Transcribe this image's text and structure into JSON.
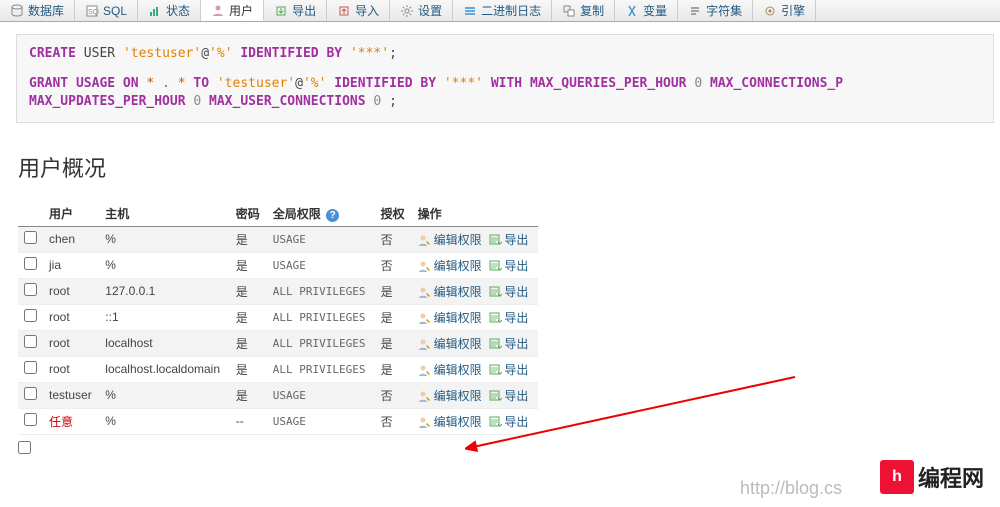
{
  "tabs": [
    {
      "label": "数据库",
      "icon": "database-icon"
    },
    {
      "label": "SQL",
      "icon": "sql-icon"
    },
    {
      "label": "状态",
      "icon": "status-icon"
    },
    {
      "label": "用户",
      "icon": "users-icon",
      "active": true
    },
    {
      "label": "导出",
      "icon": "export-icon"
    },
    {
      "label": "导入",
      "icon": "import-icon"
    },
    {
      "label": "设置",
      "icon": "settings-icon"
    },
    {
      "label": "二进制日志",
      "icon": "binlog-icon"
    },
    {
      "label": "复制",
      "icon": "replication-icon"
    },
    {
      "label": "变量",
      "icon": "variables-icon"
    },
    {
      "label": "字符集",
      "icon": "charset-icon"
    },
    {
      "label": "引擎",
      "icon": "engine-icon"
    }
  ],
  "sql": {
    "kw_create": "CREATE",
    "kw_user": "USER",
    "s1_user": "'testuser'",
    "at": "@",
    "s1_host": "'%'",
    "kw_identified": "IDENTIFIED BY",
    "s1_pwd": "'***'",
    "semi": ";",
    "kw_grant": "GRANT USAGE ON",
    "star": "* . *",
    "kw_to": "TO",
    "s2_user": "'testuser'",
    "s2_host": "'%'",
    "s2_pwd": "'***'",
    "kw_with": "WITH",
    "opt1": "MAX_QUERIES_PER_HOUR",
    "n0a": "0",
    "opt2": "MAX_CONNECTIONS_P",
    "opt3": "MAX_UPDATES_PER_HOUR",
    "n0b": "0",
    "opt4": "MAX_USER_CONNECTIONS",
    "n0c": "0"
  },
  "section_title": "用户概况",
  "headers": {
    "user": "用户",
    "host": "主机",
    "pwd": "密码",
    "global": "全局权限",
    "grant": "授权",
    "action": "操作"
  },
  "yes": "是",
  "no": "否",
  "dash": "--",
  "priv_usage": "USAGE",
  "priv_all": "ALL PRIVILEGES",
  "action_edit": "编辑权限",
  "action_export": "导出",
  "rows": [
    {
      "user": "chen",
      "host": "%",
      "pwd": "yes",
      "priv": "usage",
      "grant": "no"
    },
    {
      "user": "jia",
      "host": "%",
      "pwd": "yes",
      "priv": "usage",
      "grant": "no"
    },
    {
      "user": "root",
      "host": "127.0.0.1",
      "pwd": "yes",
      "priv": "all",
      "grant": "yes"
    },
    {
      "user": "root",
      "host": "::1",
      "pwd": "yes",
      "priv": "all",
      "grant": "yes"
    },
    {
      "user": "root",
      "host": "localhost",
      "pwd": "yes",
      "priv": "all",
      "grant": "yes"
    },
    {
      "user": "root",
      "host": "localhost.localdomain",
      "pwd": "yes",
      "priv": "all",
      "grant": "yes"
    },
    {
      "user": "testuser",
      "host": "%",
      "pwd": "yes",
      "priv": "usage",
      "grant": "no"
    },
    {
      "user": "任意",
      "host": "%",
      "pwd": "dash",
      "priv": "usage",
      "grant": "no",
      "red": true
    }
  ],
  "watermark": "http://blog.cs",
  "logo_label": "编程网",
  "logo_mark": "h"
}
